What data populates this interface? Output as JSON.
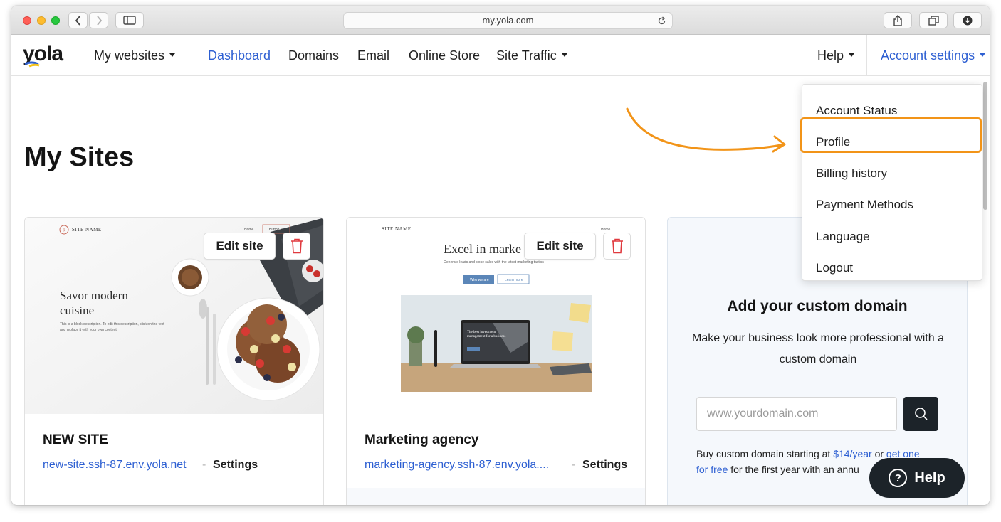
{
  "browser": {
    "url": "my.yola.com"
  },
  "nav": {
    "logo": "yola",
    "my_websites": "My websites",
    "dashboard": "Dashboard",
    "domains": "Domains",
    "email": "Email",
    "online_store": "Online Store",
    "site_traffic": "Site Traffic",
    "help": "Help",
    "account_settings": "Account settings"
  },
  "page": {
    "title": "My Sites"
  },
  "sites": [
    {
      "name": "NEW SITE",
      "url": "new-site.ssh-87.env.yola.net",
      "settings": "Settings",
      "edit": "Edit site",
      "preview": {
        "site_name": "SITE NAME",
        "menu_home": "Home",
        "menu_button": "Button 2",
        "headline_1": "Savor modern",
        "headline_2": "cuisine",
        "desc_1": "This is a block description. To edit this description, click on the text",
        "desc_2": "and replace it with your own content."
      }
    },
    {
      "name": "Marketing agency",
      "url": "marketing-agency.ssh-87.env.yola....",
      "settings": "Settings",
      "edit": "Edit site",
      "preview": {
        "site_name": "SITE NAME",
        "menu_home": "Home",
        "headline": "Excel in marke",
        "sub": "Generate leads and close sales with the latest marketing tactics",
        "btn1": "Who we are",
        "btn2": "Learn more",
        "screen_text_1": "The best investment",
        "screen_text_2": "management for a business"
      }
    }
  ],
  "separator": "-",
  "domain_card": {
    "title": "Add your custom domain",
    "subtitle": "Make your business look more professional with a custom domain",
    "input_placeholder": "www.yourdomain.com",
    "foot_text_1": "Buy custom domain starting at ",
    "foot_price": "$14/year",
    "foot_text_2": " or ",
    "foot_free_a": "get one",
    "foot_free_b": "for free",
    "foot_text_3": " for the first year with an annu"
  },
  "dropdown": {
    "items": [
      "Account Status",
      "Profile",
      "Billing history",
      "Payment Methods",
      "Language",
      "Logout"
    ],
    "highlighted": "Profile"
  },
  "help_button": "Help",
  "colors": {
    "accent": "#2d5fd2",
    "highlight": "#f29418",
    "dark": "#1c2329"
  }
}
